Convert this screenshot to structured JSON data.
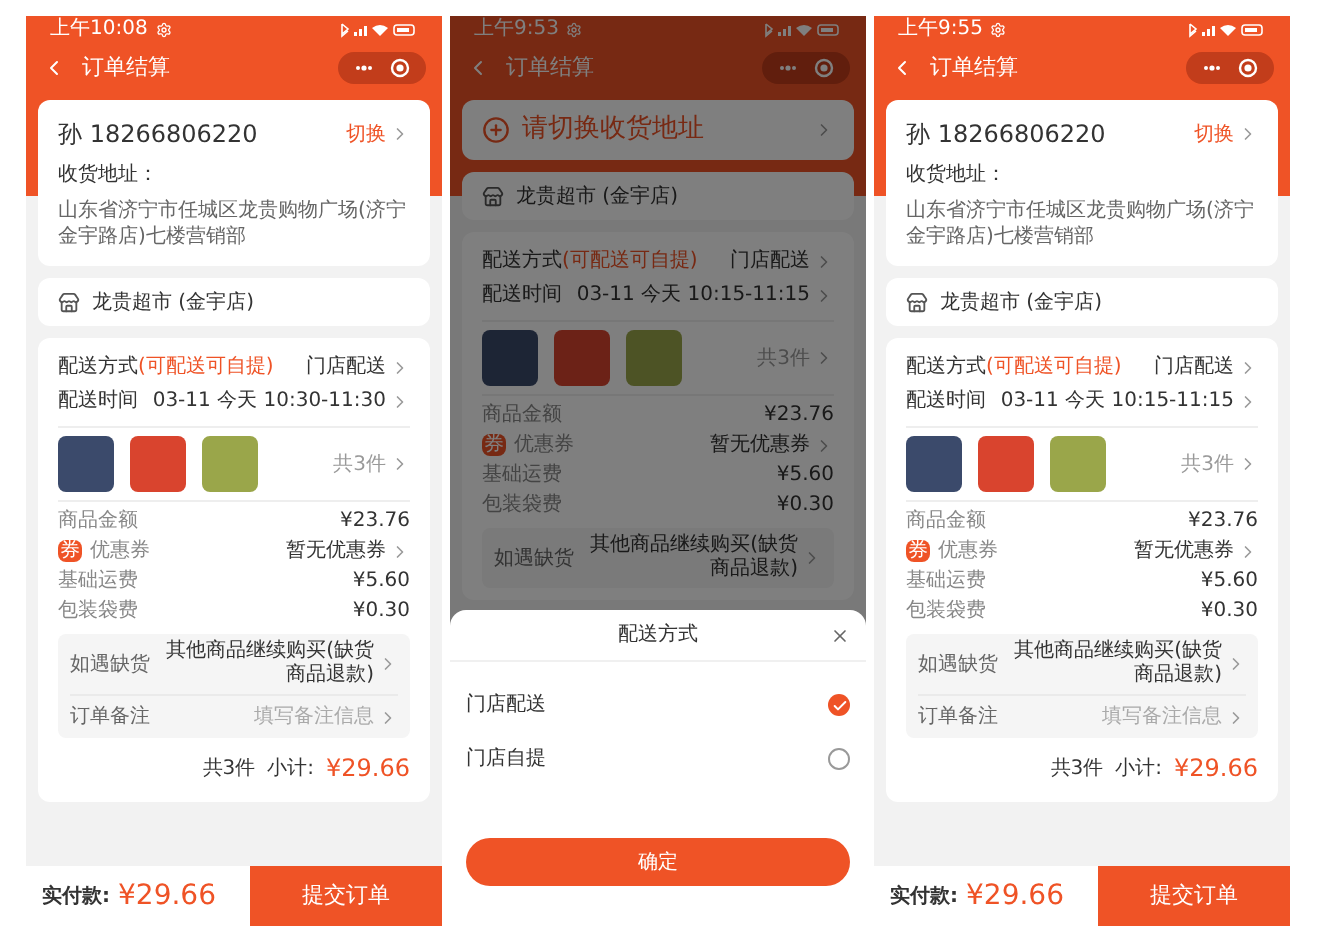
{
  "screens": [
    {
      "status_time": "上午10:08",
      "title": "订单结算",
      "address": {
        "kind": "filled",
        "name_phone": "孙 18266806220",
        "switch": "切换",
        "label": "收货地址：",
        "text": "山东省济宁市任城区龙贵购物广场(济宁金宇路店)七楼营销部"
      },
      "store": "龙贵超市 (金宇店)",
      "delivery": [
        {
          "label": "配送方式",
          "note": "(可配送可自提)",
          "value": "门店配送"
        },
        {
          "label": "配送时间",
          "value": "03-11 今天 10:30-11:30"
        }
      ],
      "items_count": "共3件",
      "fees": [
        {
          "label": "商品金额",
          "value": "¥23.76",
          "link": false
        },
        {
          "label": "优惠券",
          "badge": "券",
          "value": "暂无优惠券",
          "link": true
        },
        {
          "label": "基础运费",
          "value": "¥5.60",
          "link": false
        },
        {
          "label": "包装袋费",
          "value": "¥0.30",
          "link": false
        }
      ],
      "options": [
        {
          "label": "如遇缺货",
          "value": "其他商品继续购买(缺货商品退款)"
        },
        {
          "label": "订单备注",
          "placeholder": "填写备注信息"
        }
      ],
      "subtotal": {
        "count": "共3件",
        "label": "小计:",
        "amount": "¥29.66"
      },
      "bottom_bar": {
        "label": "实付款:",
        "amount": "¥29.66",
        "submit": "提交订单"
      }
    },
    {
      "status_time": "上午9:53",
      "title": "订单结算",
      "address": {
        "kind": "prompt",
        "text": "请切换收货地址"
      },
      "store": "龙贵超市 (金宇店)",
      "delivery": [
        {
          "label": "配送方式",
          "note": "(可配送可自提)",
          "value": "门店配送"
        },
        {
          "label": "配送时间",
          "value": "03-11 今天 10:15-11:15"
        }
      ],
      "items_count": "共3件",
      "fees": [
        {
          "label": "商品金额",
          "value": "¥23.76",
          "link": false
        },
        {
          "label": "优惠券",
          "badge": "券",
          "value": "暂无优惠券",
          "link": true
        },
        {
          "label": "基础运费",
          "value": "¥5.60",
          "link": false
        },
        {
          "label": "包装袋费",
          "value": "¥0.30",
          "link": false
        }
      ],
      "options": [
        {
          "label": "如遇缺货",
          "value": "其他商品继续购买(缺货商品退款)"
        }
      ],
      "sheet": {
        "title": "配送方式",
        "options": [
          {
            "label": "门店配送",
            "selected": true
          },
          {
            "label": "门店自提",
            "selected": false
          }
        ],
        "confirm": "确定"
      }
    },
    {
      "status_time": "上午9:55",
      "title": "订单结算",
      "address": {
        "kind": "filled",
        "name_phone": "孙 18266806220",
        "switch": "切换",
        "label": "收货地址：",
        "text": "山东省济宁市任城区龙贵购物广场(济宁金宇路店)七楼营销部"
      },
      "store": "龙贵超市 (金宇店)",
      "delivery": [
        {
          "label": "配送方式",
          "note": "(可配送可自提)",
          "value": "门店配送"
        },
        {
          "label": "配送时间",
          "value": "03-11 今天 10:15-11:15"
        }
      ],
      "items_count": "共3件",
      "fees": [
        {
          "label": "商品金额",
          "value": "¥23.76",
          "link": false
        },
        {
          "label": "优惠券",
          "badge": "券",
          "value": "暂无优惠券",
          "link": true
        },
        {
          "label": "基础运费",
          "value": "¥5.60",
          "link": false
        },
        {
          "label": "包装袋费",
          "value": "¥0.30",
          "link": false
        }
      ],
      "options": [
        {
          "label": "如遇缺货",
          "value": "其他商品继续购买(缺货商品退款)"
        },
        {
          "label": "订单备注",
          "placeholder": "填写备注信息"
        }
      ],
      "subtotal": {
        "count": "共3件",
        "label": "小计:",
        "amount": "¥29.66"
      },
      "bottom_bar": {
        "label": "实付款:",
        "amount": "¥29.66",
        "submit": "提交订单"
      }
    }
  ]
}
